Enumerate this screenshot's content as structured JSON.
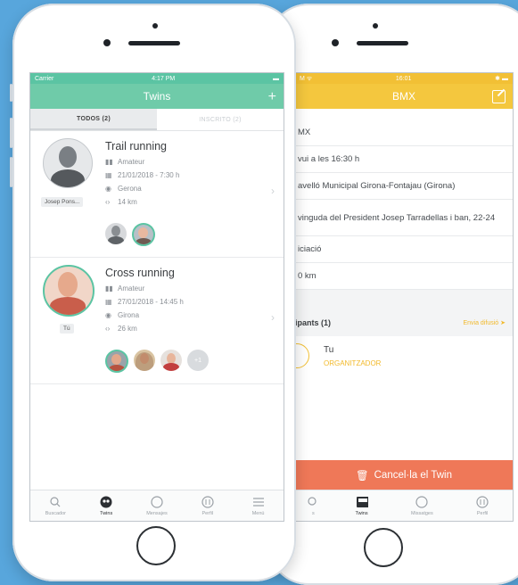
{
  "front": {
    "status": {
      "carrier": "Carrier",
      "time": "4:17 PM"
    },
    "nav": {
      "title": "Twins",
      "add_icon": "plus-icon"
    },
    "segments": {
      "all": "TODOS (2)",
      "joined": "INSCRITO (2)"
    },
    "events": [
      {
        "title": "Trail running",
        "level": "Amateur",
        "datetime": "21/01/2018 - 7:30 h",
        "location": "Gerona",
        "distance": "14 km",
        "owner_tag": "Josep Pons...",
        "participant_count_extra": ""
      },
      {
        "title": "Cross running",
        "level": "Amateur",
        "datetime": "27/01/2018 - 14:45 h",
        "location": "Girona",
        "distance": "26 km",
        "owner_tag": "Tú",
        "participant_count_extra": "+1"
      }
    ],
    "tabs": [
      {
        "label": "Buscador",
        "icon": "search-icon"
      },
      {
        "label": "Twins",
        "icon": "twins-icon"
      },
      {
        "label": "Mensajes",
        "icon": "chat-icon"
      },
      {
        "label": "Perfil",
        "icon": "profile-icon"
      },
      {
        "label": "Menú",
        "icon": "menu-icon"
      }
    ]
  },
  "back": {
    "status": {
      "time": "16:01"
    },
    "nav": {
      "title": "BMX",
      "edit_icon": "edit-icon"
    },
    "details": {
      "sport": "MX",
      "when": "vui a les 16:30 h",
      "venue": "avelló Municipal Girona-Fontajau (Girona)",
      "address": "vinguda del President Josep Tarradellas i ban, 22-24",
      "level": "iciació",
      "distance": "0 km"
    },
    "participants": {
      "label": "ipants (1)",
      "send": "Envia difusió"
    },
    "organizer": {
      "name": "Tu",
      "role": "ORGANITZADOR"
    },
    "cancel": {
      "label": "Cancel·la el Twin"
    },
    "tabs": [
      {
        "label": "s",
        "icon": "search-icon"
      },
      {
        "label": "Twins",
        "icon": "twins-icon"
      },
      {
        "label": "Missatges",
        "icon": "chat-icon"
      },
      {
        "label": "Perfil",
        "icon": "profile-icon"
      }
    ]
  }
}
